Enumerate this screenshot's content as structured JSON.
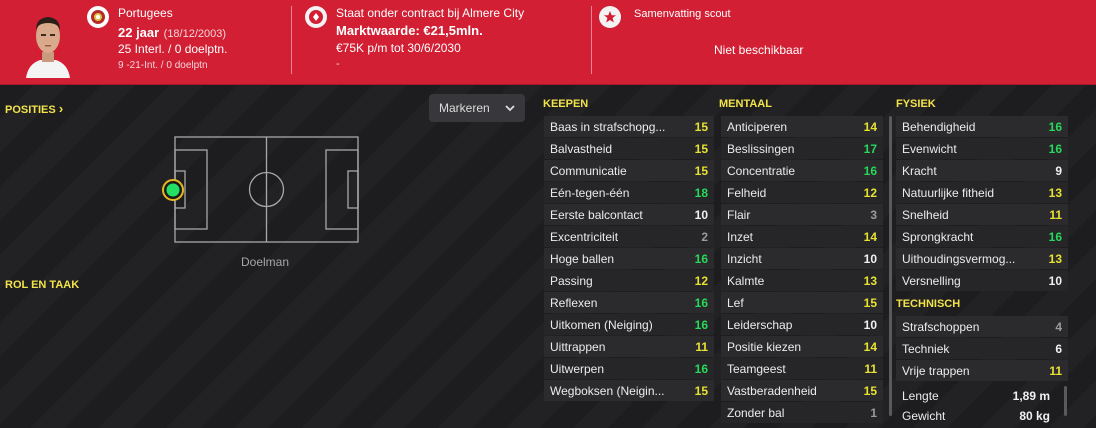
{
  "header": {
    "nationality": "Portugees",
    "age": "22 jaar",
    "dob": "(18/12/2003)",
    "intl_caps": "25 Interl. / 0 doelptn.",
    "u21_caps": "9 -21-Int. / 0 doelptn",
    "contract": "Staat onder contract bij Almere City",
    "market_value": "Marktwaarde: €21,5mln.",
    "wage": "€75K p/m tot 30/6/2030",
    "dash": "-",
    "scout_title": "Samenvatting scout",
    "scout_value": "Niet beschikbaar"
  },
  "left": {
    "positions_label": "POSITIES",
    "positions_chevron": "›",
    "mark_button": "Markeren",
    "position_name": "Doelman",
    "role_label": "ROL EN TAAK"
  },
  "keepen": {
    "title": "KEEPEN",
    "items": [
      {
        "label": "Baas in strafschopg...",
        "value": "15",
        "color": "#e7e232"
      },
      {
        "label": "Balvastheid",
        "value": "15",
        "color": "#e7e232"
      },
      {
        "label": "Communicatie",
        "value": "15",
        "color": "#e7e232"
      },
      {
        "label": "Eén-tegen-één",
        "value": "18",
        "color": "#27d85a"
      },
      {
        "label": "Eerste balcontact",
        "value": "10",
        "color": "#f0f0f0"
      },
      {
        "label": "Excentriciteit",
        "value": "2",
        "color": "#9a9a9a"
      },
      {
        "label": "Hoge ballen",
        "value": "16",
        "color": "#27d85a"
      },
      {
        "label": "Passing",
        "value": "12",
        "color": "#e7e232"
      },
      {
        "label": "Reflexen",
        "value": "16",
        "color": "#27d85a"
      },
      {
        "label": "Uitkomen (Neiging)",
        "value": "16",
        "color": "#27d85a"
      },
      {
        "label": "Uittrappen",
        "value": "11",
        "color": "#e7e232"
      },
      {
        "label": "Uitwerpen",
        "value": "16",
        "color": "#27d85a"
      },
      {
        "label": "Wegboksen (Neigin...",
        "value": "15",
        "color": "#e7e232"
      }
    ]
  },
  "mentaal": {
    "title": "MENTAAL",
    "items": [
      {
        "label": "Anticiperen",
        "value": "14",
        "color": "#e7e232"
      },
      {
        "label": "Beslissingen",
        "value": "17",
        "color": "#27d85a"
      },
      {
        "label": "Concentratie",
        "value": "16",
        "color": "#27d85a"
      },
      {
        "label": "Felheid",
        "value": "12",
        "color": "#e7e232"
      },
      {
        "label": "Flair",
        "value": "3",
        "color": "#9a9a9a"
      },
      {
        "label": "Inzet",
        "value": "14",
        "color": "#e7e232"
      },
      {
        "label": "Inzicht",
        "value": "10",
        "color": "#f0f0f0"
      },
      {
        "label": "Kalmte",
        "value": "13",
        "color": "#e7e232"
      },
      {
        "label": "Lef",
        "value": "15",
        "color": "#e7e232"
      },
      {
        "label": "Leiderschap",
        "value": "10",
        "color": "#f0f0f0"
      },
      {
        "label": "Positie kiezen",
        "value": "14",
        "color": "#e7e232"
      },
      {
        "label": "Teamgeest",
        "value": "11",
        "color": "#e7e232"
      },
      {
        "label": "Vastberadenheid",
        "value": "15",
        "color": "#e7e232"
      },
      {
        "label": "Zonder bal",
        "value": "1",
        "color": "#9a9a9a"
      }
    ]
  },
  "fysiek": {
    "title": "FYSIEK",
    "items": [
      {
        "label": "Behendigheid",
        "value": "16",
        "color": "#27d85a"
      },
      {
        "label": "Evenwicht",
        "value": "16",
        "color": "#27d85a"
      },
      {
        "label": "Kracht",
        "value": "9",
        "color": "#f0f0f0"
      },
      {
        "label": "Natuurlijke fitheid",
        "value": "13",
        "color": "#e7e232"
      },
      {
        "label": "Snelheid",
        "value": "11",
        "color": "#e7e232"
      },
      {
        "label": "Sprongkracht",
        "value": "16",
        "color": "#27d85a"
      },
      {
        "label": "Uithoudingsvermog...",
        "value": "13",
        "color": "#e7e232"
      },
      {
        "label": "Versnelling",
        "value": "10",
        "color": "#f0f0f0"
      }
    ]
  },
  "technisch": {
    "title": "TECHNISCH",
    "items": [
      {
        "label": "Strafschoppen",
        "value": "4",
        "color": "#9a9a9a"
      },
      {
        "label": "Techniek",
        "value": "6",
        "color": "#f0f0f0"
      },
      {
        "label": "Vrije trappen",
        "value": "11",
        "color": "#e7e232"
      }
    ]
  },
  "body_stats": [
    {
      "label": "Lengte",
      "value": "1,89 m"
    },
    {
      "label": "Gewicht",
      "value": "80 kg"
    }
  ],
  "colors": {
    "header_red": "#d21f34",
    "accent_yellow": "#f2e34a",
    "good_green": "#27d85a"
  }
}
